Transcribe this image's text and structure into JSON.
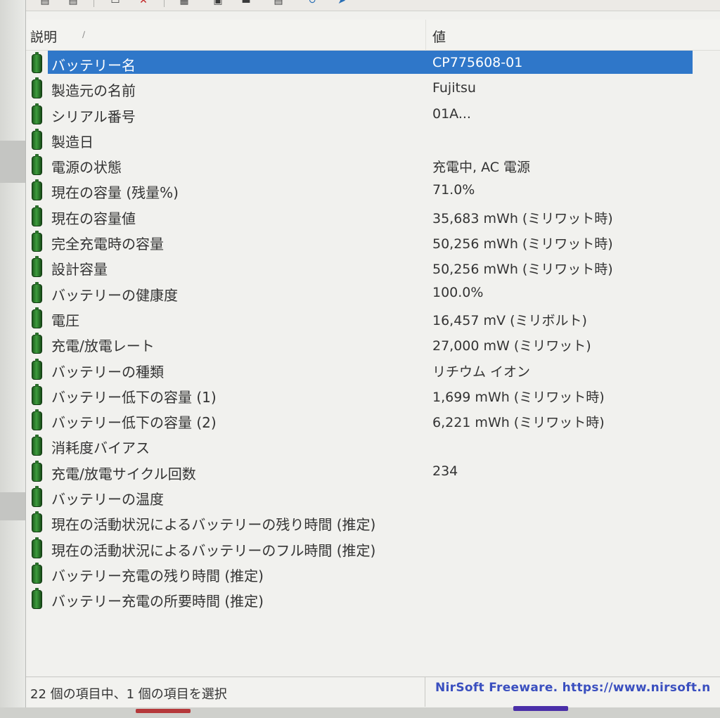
{
  "columns": {
    "description": "説明",
    "value": "値"
  },
  "rows": [
    {
      "name": "バッテリー名",
      "value": "CP775608-01",
      "selected": true
    },
    {
      "name": "製造元の名前",
      "value": "Fujitsu"
    },
    {
      "name": "シリアル番号",
      "value": "01A..."
    },
    {
      "name": "製造日",
      "value": ""
    },
    {
      "name": "電源の状態",
      "value": "充電中, AC 電源"
    },
    {
      "name": "現在の容量 (残量%)",
      "value": "71.0%"
    },
    {
      "name": "現在の容量値",
      "value": "35,683 mWh (ミリワット時)"
    },
    {
      "name": "完全充電時の容量",
      "value": "50,256 mWh (ミリワット時)"
    },
    {
      "name": "設計容量",
      "value": "50,256 mWh (ミリワット時)"
    },
    {
      "name": "バッテリーの健康度",
      "value": "100.0%"
    },
    {
      "name": "電圧",
      "value": "16,457 mV (ミリボルト)"
    },
    {
      "name": "充電/放電レート",
      "value": "27,000 mW (ミリワット)"
    },
    {
      "name": "バッテリーの種類",
      "value": "リチウム イオン"
    },
    {
      "name": "バッテリー低下の容量 (1)",
      "value": "1,699 mWh (ミリワット時)"
    },
    {
      "name": "バッテリー低下の容量 (2)",
      "value": "6,221 mWh (ミリワット時)"
    },
    {
      "name": "消耗度バイアス",
      "value": ""
    },
    {
      "name": "充電/放電サイクル回数",
      "value": "234"
    },
    {
      "name": "バッテリーの温度",
      "value": ""
    },
    {
      "name": "現在の活動状況によるバッテリーの残り時間 (推定)",
      "value": ""
    },
    {
      "name": "現在の活動状況によるバッテリーのフル時間 (推定)",
      "value": ""
    },
    {
      "name": "バッテリー充電の残り時間 (推定)",
      "value": ""
    },
    {
      "name": "バッテリー充電の所要時間 (推定)",
      "value": ""
    }
  ],
  "status": {
    "selection": "22 個の項目中、1 個の項目を選択",
    "credit": "NirSoft Freeware. https://www.nirsoft.n"
  },
  "icons": {
    "row_icon": "battery-icon"
  },
  "colors": {
    "selection": "#2f77c9",
    "credit_link": "#3a4fbf"
  }
}
